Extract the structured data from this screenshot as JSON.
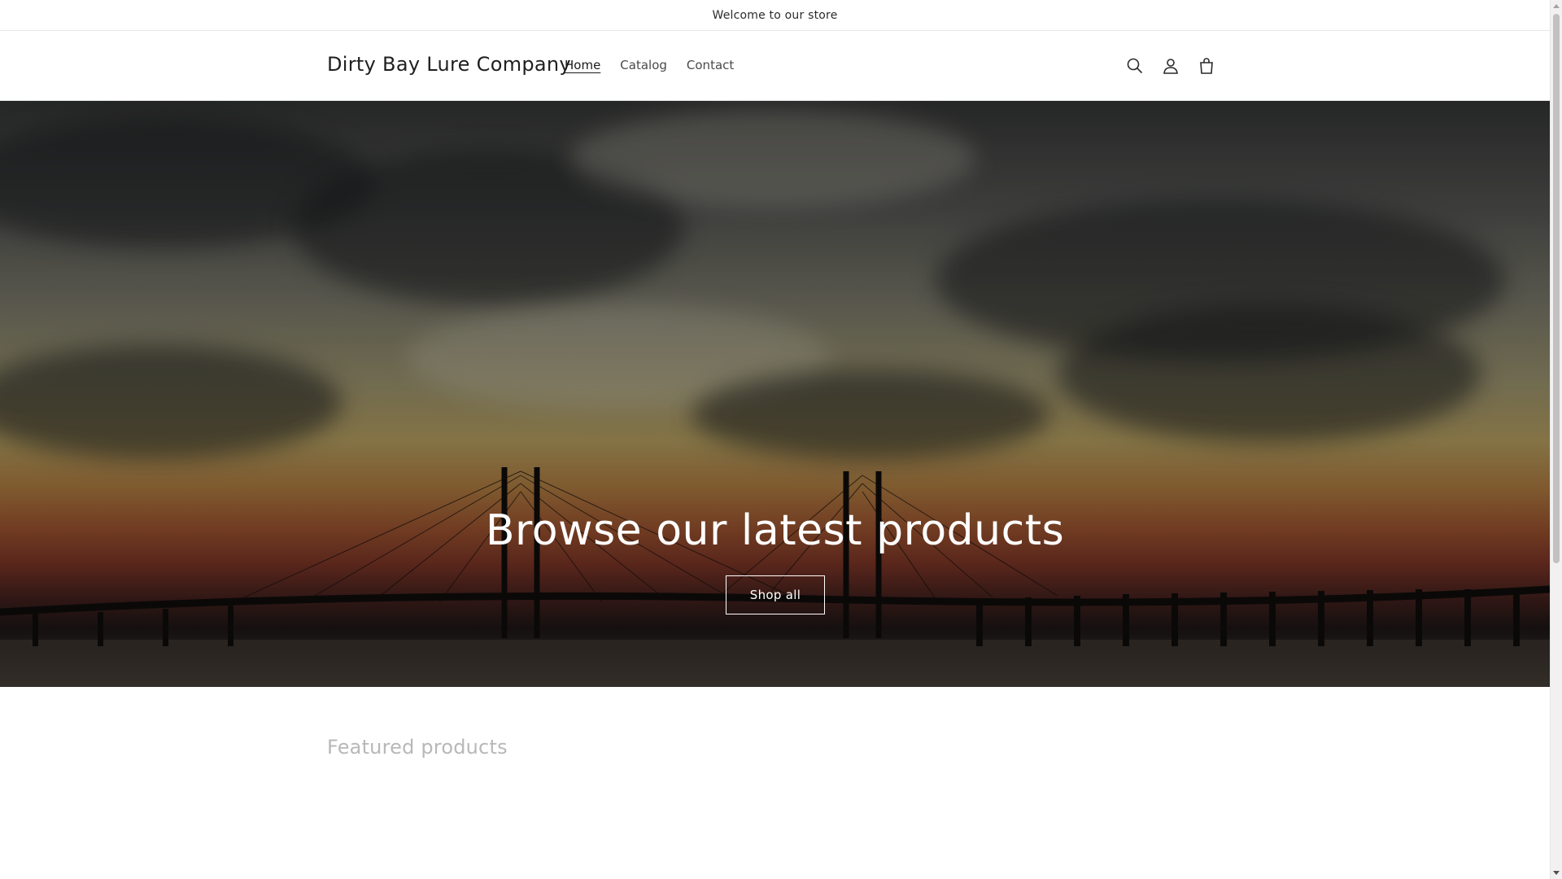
{
  "announcement": {
    "text": "Welcome to our store"
  },
  "header": {
    "logo": "Dirty Bay Lure Company",
    "nav": [
      {
        "label": "Home",
        "active": true
      },
      {
        "label": "Catalog",
        "active": false
      },
      {
        "label": "Contact",
        "active": false
      }
    ],
    "icons": [
      "search-icon",
      "account-icon",
      "cart-icon"
    ]
  },
  "hero": {
    "title": "Browse our latest products",
    "button_label": "Shop all"
  },
  "featured": {
    "title": "Featured products"
  },
  "colors": {
    "text": "#121212",
    "muted_heading": "#b8b8b8",
    "border": "#e6e6e6",
    "hero_text": "#ffffff"
  }
}
